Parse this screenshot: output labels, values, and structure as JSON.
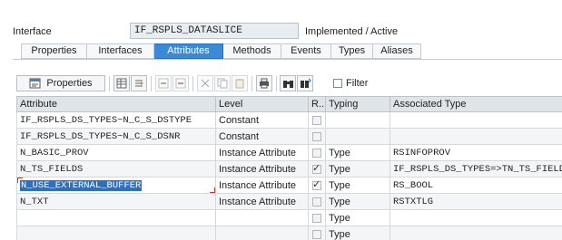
{
  "header": {
    "interface_label": "Interface",
    "interface_name": "IF_RSPLS_DATASLICE",
    "status": "Implemented / Active"
  },
  "tabs": [
    {
      "label": "Properties",
      "active": false
    },
    {
      "label": "Interfaces",
      "active": false
    },
    {
      "label": "Attributes",
      "active": true
    },
    {
      "label": "Methods",
      "active": false
    },
    {
      "label": "Events",
      "active": false
    },
    {
      "label": "Types",
      "active": false
    },
    {
      "label": "Aliases",
      "active": false
    }
  ],
  "toolbar": {
    "properties_label": "Properties",
    "filter_label": "Filter",
    "filter_checked": false
  },
  "table": {
    "columns": [
      "Attribute",
      "Level",
      "R...",
      "Typing",
      "Associated Type"
    ],
    "rows": [
      {
        "attribute": "IF_RSPLS_DS_TYPES~N_C_S_DSTYPE",
        "level": "Constant",
        "readonly": false,
        "typing": "",
        "assoc": ""
      },
      {
        "attribute": "IF_RSPLS_DS_TYPES~N_C_S_DSNR",
        "level": "Constant",
        "readonly": false,
        "typing": "",
        "assoc": ""
      },
      {
        "attribute": "N_BASIC_PROV",
        "level": "Instance Attribute",
        "readonly": false,
        "typing": "Type",
        "assoc": "RSINFOPROV"
      },
      {
        "attribute": "N_TS_FIELDS",
        "level": "Instance Attribute",
        "readonly": true,
        "typing": "Type",
        "assoc": "IF_RSPLS_DS_TYPES=>TN_TS_FIELD"
      },
      {
        "attribute": "N_USE_EXTERNAL_BUFFER",
        "level": "Instance Attribute",
        "readonly": true,
        "typing": "Type",
        "assoc": "RS_BOOL",
        "selected": true
      },
      {
        "attribute": "N_TXT",
        "level": "Instance Attribute",
        "readonly": false,
        "typing": "Type",
        "assoc": "RSTXTLG"
      },
      {
        "attribute": "",
        "level": "",
        "readonly": false,
        "typing": "Type",
        "assoc": ""
      },
      {
        "attribute": "",
        "level": "",
        "readonly": false,
        "typing": "Type",
        "assoc": ""
      }
    ]
  },
  "colors": {
    "active_tab": "#3a8ad8",
    "selection": "#2f6fc0",
    "header_bg": "#dfe4e9"
  }
}
